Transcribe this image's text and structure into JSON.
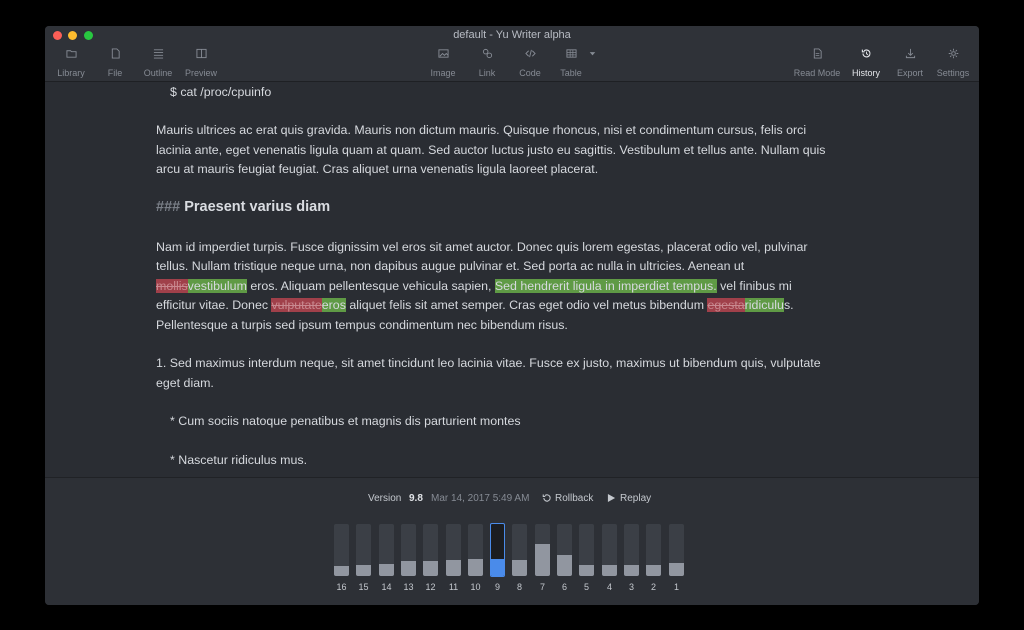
{
  "window": {
    "title": "default - Yu Writer alpha"
  },
  "toolbar": {
    "left": [
      {
        "label": "Library",
        "icon": "folder-icon"
      },
      {
        "label": "File",
        "icon": "file-icon"
      },
      {
        "label": "Outline",
        "icon": "list-icon"
      },
      {
        "label": "Preview",
        "icon": "columns-icon"
      }
    ],
    "center": [
      {
        "label": "Image",
        "icon": "image-icon"
      },
      {
        "label": "Link",
        "icon": "link-icon"
      },
      {
        "label": "Code",
        "icon": "code-icon"
      },
      {
        "label": "Table",
        "icon": "table-icon"
      }
    ],
    "right": [
      {
        "label": "Read Mode",
        "icon": "document-icon"
      },
      {
        "label": "History",
        "icon": "history-icon",
        "active": true
      },
      {
        "label": "Export",
        "icon": "export-icon"
      },
      {
        "label": "Settings",
        "icon": "gear-icon"
      }
    ]
  },
  "editor": {
    "code_line": "$ cat /proc/cpuinfo",
    "para1": [
      "Mauris ultrices ac erat quis gravida. Mauris non dictum mauris. Quisque rhoncus, nisi et condimentum cursus, felis orci",
      "lacinia ante, eget venenatis ligula quam at quam. Sed auctor luctus justo eu sagittis. Vestibulum et tellus ante. Nullam quis",
      "arcu at mauris feugiat feugiat. Cras aliquet urna venenatis ligula laoreet placerat."
    ],
    "heading_hash": "###",
    "heading_text": "Praesent varius diam",
    "para2": {
      "l1": "Nam id imperdiet turpis. Fusce dignissim vel eros sit amet auctor. Donec quis lorem egestas, placerat odio vel, pulvinar",
      "l2": "tellus. Nullam tristique neque urna, non dapibus augue pulvinar et. Sed porta ac nulla in ultricies. Aenean ut",
      "l3_del1": "mollis",
      "l3_add1": "vestibulum",
      "l3_mid": " eros. Aliquam pellentesque vehicula sapien, ",
      "l3_add2": "Sed hendrerit ligula in imperdiet tempus.",
      "l3_end": " vel finibus mi",
      "l4_start": "efficitur vitae. Donec ",
      "l4_del1": "vulputate",
      "l4_add1": "eros",
      "l4_mid": " aliquet felis sit amet semper. Cras eget odio vel metus bibendum ",
      "l4_del2": "egesta",
      "l4_add2": "ridiculu",
      "l4_end": "s.",
      "l5": "Pellentesque a turpis sed ipsum tempus condimentum nec bibendum risus."
    },
    "list1": [
      " 1. Sed maximus interdum neque, sit amet tincidunt leo lacinia vitae. Fusce ex justo, maximus ut bibendum quis, vulputate",
      "eget diam."
    ],
    "bullet1": "* Cum sociis natoque penatibus et magnis dis parturient montes",
    "bullet2": "* Nascetur ridiculus mus."
  },
  "history": {
    "version_label": "Version",
    "version_number": "9.8",
    "date": "Mar 14, 2017 5:49 AM",
    "rollback_label": "Rollback",
    "replay_label": "Replay",
    "selected_version": "9",
    "versions": [
      {
        "label": "16",
        "level": 0.2
      },
      {
        "label": "15",
        "level": 0.21
      },
      {
        "label": "14",
        "level": 0.23
      },
      {
        "label": "13",
        "level": 0.29
      },
      {
        "label": "12",
        "level": 0.28
      },
      {
        "label": "11",
        "level": 0.31
      },
      {
        "label": "10",
        "level": 0.32
      },
      {
        "label": "9",
        "level": 0.33
      },
      {
        "label": "8",
        "level": 0.31
      },
      {
        "label": "7",
        "level": 0.61
      },
      {
        "label": "6",
        "level": 0.4
      },
      {
        "label": "5",
        "level": 0.21
      },
      {
        "label": "4",
        "level": 0.21
      },
      {
        "label": "3",
        "level": 0.21
      },
      {
        "label": "2",
        "level": 0.21
      },
      {
        "label": "1",
        "level": 0.25
      }
    ],
    "colors": {
      "selected": "#4a8bea",
      "fill": "#9196a0"
    }
  }
}
